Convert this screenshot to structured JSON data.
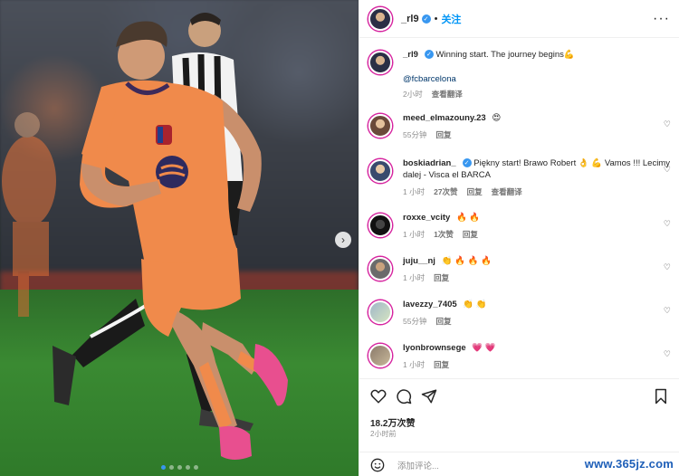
{
  "post": {
    "author": "_rl9",
    "follow_label": "关注",
    "separator": "•",
    "caption": "Winning start. The journey begins💪",
    "caption_mention": "@fcbarcelona",
    "caption_time": "2小时",
    "caption_translate": "查看翻译",
    "carousel": {
      "slides": 5,
      "active_index": 0
    }
  },
  "comments": [
    {
      "user": "meed_elmazouny.23",
      "text": "😍",
      "time": "55分钟",
      "likes": "",
      "reply": "回复",
      "translate": "",
      "verified": false
    },
    {
      "user": "boskiadrian_",
      "text": "Piękny start! Brawo Robert 👌 💪 Vamos !!! Lecimy dalej - Visca el BARCA",
      "time": "1 小时",
      "likes": "27次赞",
      "reply": "回复",
      "translate": "查看翻译",
      "verified": true
    },
    {
      "user": "roxxe_vcity",
      "text": "🔥 🔥",
      "time": "1 小时",
      "likes": "1次赞",
      "reply": "回复",
      "translate": "",
      "verified": false
    },
    {
      "user": "juju__nj",
      "text": "👏 🔥 🔥 🔥",
      "time": "1 小时",
      "likes": "",
      "reply": "回复",
      "translate": "",
      "verified": false
    },
    {
      "user": "lavezzy_7405",
      "text": "👏 👏",
      "time": "55分钟",
      "likes": "",
      "reply": "回复",
      "translate": "",
      "verified": false
    },
    {
      "user": "lyonbrownsege",
      "text": "💗 💗",
      "time": "1 小时",
      "likes": "",
      "reply": "回复",
      "translate": "",
      "verified": false
    }
  ],
  "stats": {
    "likes": "18.2万次赞",
    "posted": "2小时前"
  },
  "composer": {
    "placeholder": "添加评论..."
  },
  "watermark": "www.365jz.com",
  "colors": {
    "link_blue": "#0095f6",
    "verified_blue": "#3897f0",
    "meta_gray": "#8e8e8e",
    "jersey_orange": "#f08a4b"
  },
  "icons": [
    "heart-icon",
    "comment-icon",
    "share-icon",
    "bookmark-icon",
    "emoji-icon",
    "more-icon",
    "chevron-right-icon"
  ]
}
